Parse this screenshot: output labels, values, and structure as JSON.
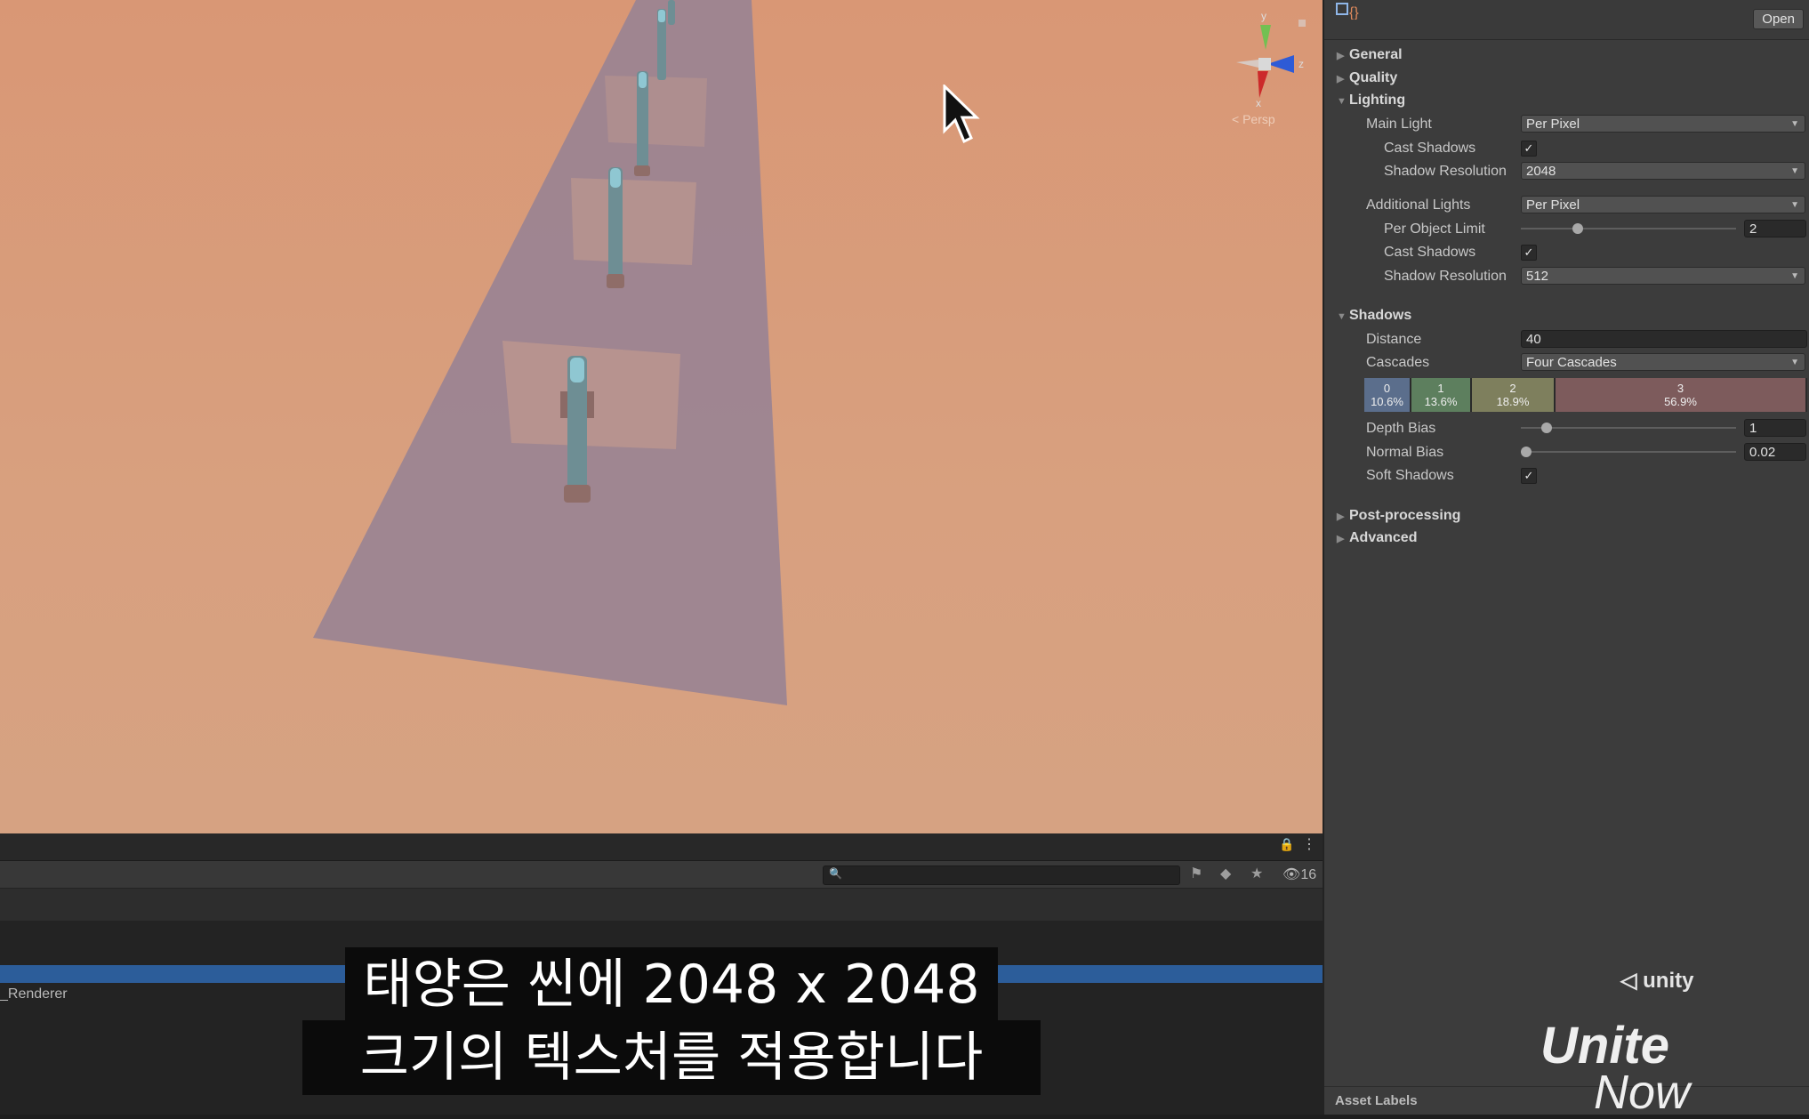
{
  "scene": {
    "view_mode": "< Persp",
    "gizmo_axes": {
      "y": "y",
      "x": "x",
      "z": "z"
    }
  },
  "inspector": {
    "open_label": "Open",
    "sections": {
      "general": "General",
      "quality": "Quality",
      "lighting": "Lighting",
      "shadows": "Shadows",
      "post_processing": "Post-processing",
      "advanced": "Advanced"
    },
    "lighting": {
      "main_light_label": "Main Light",
      "main_light_value": "Per Pixel",
      "main_cast_shadows_label": "Cast Shadows",
      "main_cast_shadows_checked": "✓",
      "main_shadow_res_label": "Shadow Resolution",
      "main_shadow_res_value": "2048",
      "additional_lights_label": "Additional Lights",
      "additional_lights_value": "Per Pixel",
      "per_object_limit_label": "Per Object Limit",
      "per_object_limit_value": "2",
      "per_object_limit_fraction": 0.25,
      "add_cast_shadows_label": "Cast Shadows",
      "add_cast_shadows_checked": "✓",
      "add_shadow_res_label": "Shadow Resolution",
      "add_shadow_res_value": "512"
    },
    "shadows": {
      "distance_label": "Distance",
      "distance_value": "40",
      "cascades_label": "Cascades",
      "cascades_value": "Four Cascades",
      "cascade_splits": [
        {
          "index": "0",
          "percent": "10.6%",
          "color": "#5b6e8c",
          "fraction": 0.106
        },
        {
          "index": "1",
          "percent": "13.6%",
          "color": "#5d7f5e",
          "fraction": 0.136
        },
        {
          "index": "2",
          "percent": "18.9%",
          "color": "#7e7f5d",
          "fraction": 0.189
        },
        {
          "index": "3",
          "percent": "56.9%",
          "color": "#7d5b5c",
          "fraction": 0.569
        }
      ],
      "depth_bias_label": "Depth Bias",
      "depth_bias_value": "1",
      "depth_bias_fraction": 0.1,
      "normal_bias_label": "Normal Bias",
      "normal_bias_value": "0.02",
      "normal_bias_fraction": 0.0,
      "soft_shadows_label": "Soft Shadows",
      "soft_shadows_checked": "✓"
    },
    "asset_labels": "Asset Labels"
  },
  "bottom_panel": {
    "hidden_count": "16",
    "row_text": "_Renderer"
  },
  "subtitles": {
    "line1": "태양은 씬에 2048 x 2048",
    "line2": "크기의 텍스처를 적용합니다"
  },
  "branding": {
    "unity": "unity",
    "unite": "Unite",
    "now": "Now"
  },
  "colors": {
    "scene_bg": "#d99775",
    "shadow_strip": "#9c8494",
    "selection": "#2c5d9a"
  }
}
